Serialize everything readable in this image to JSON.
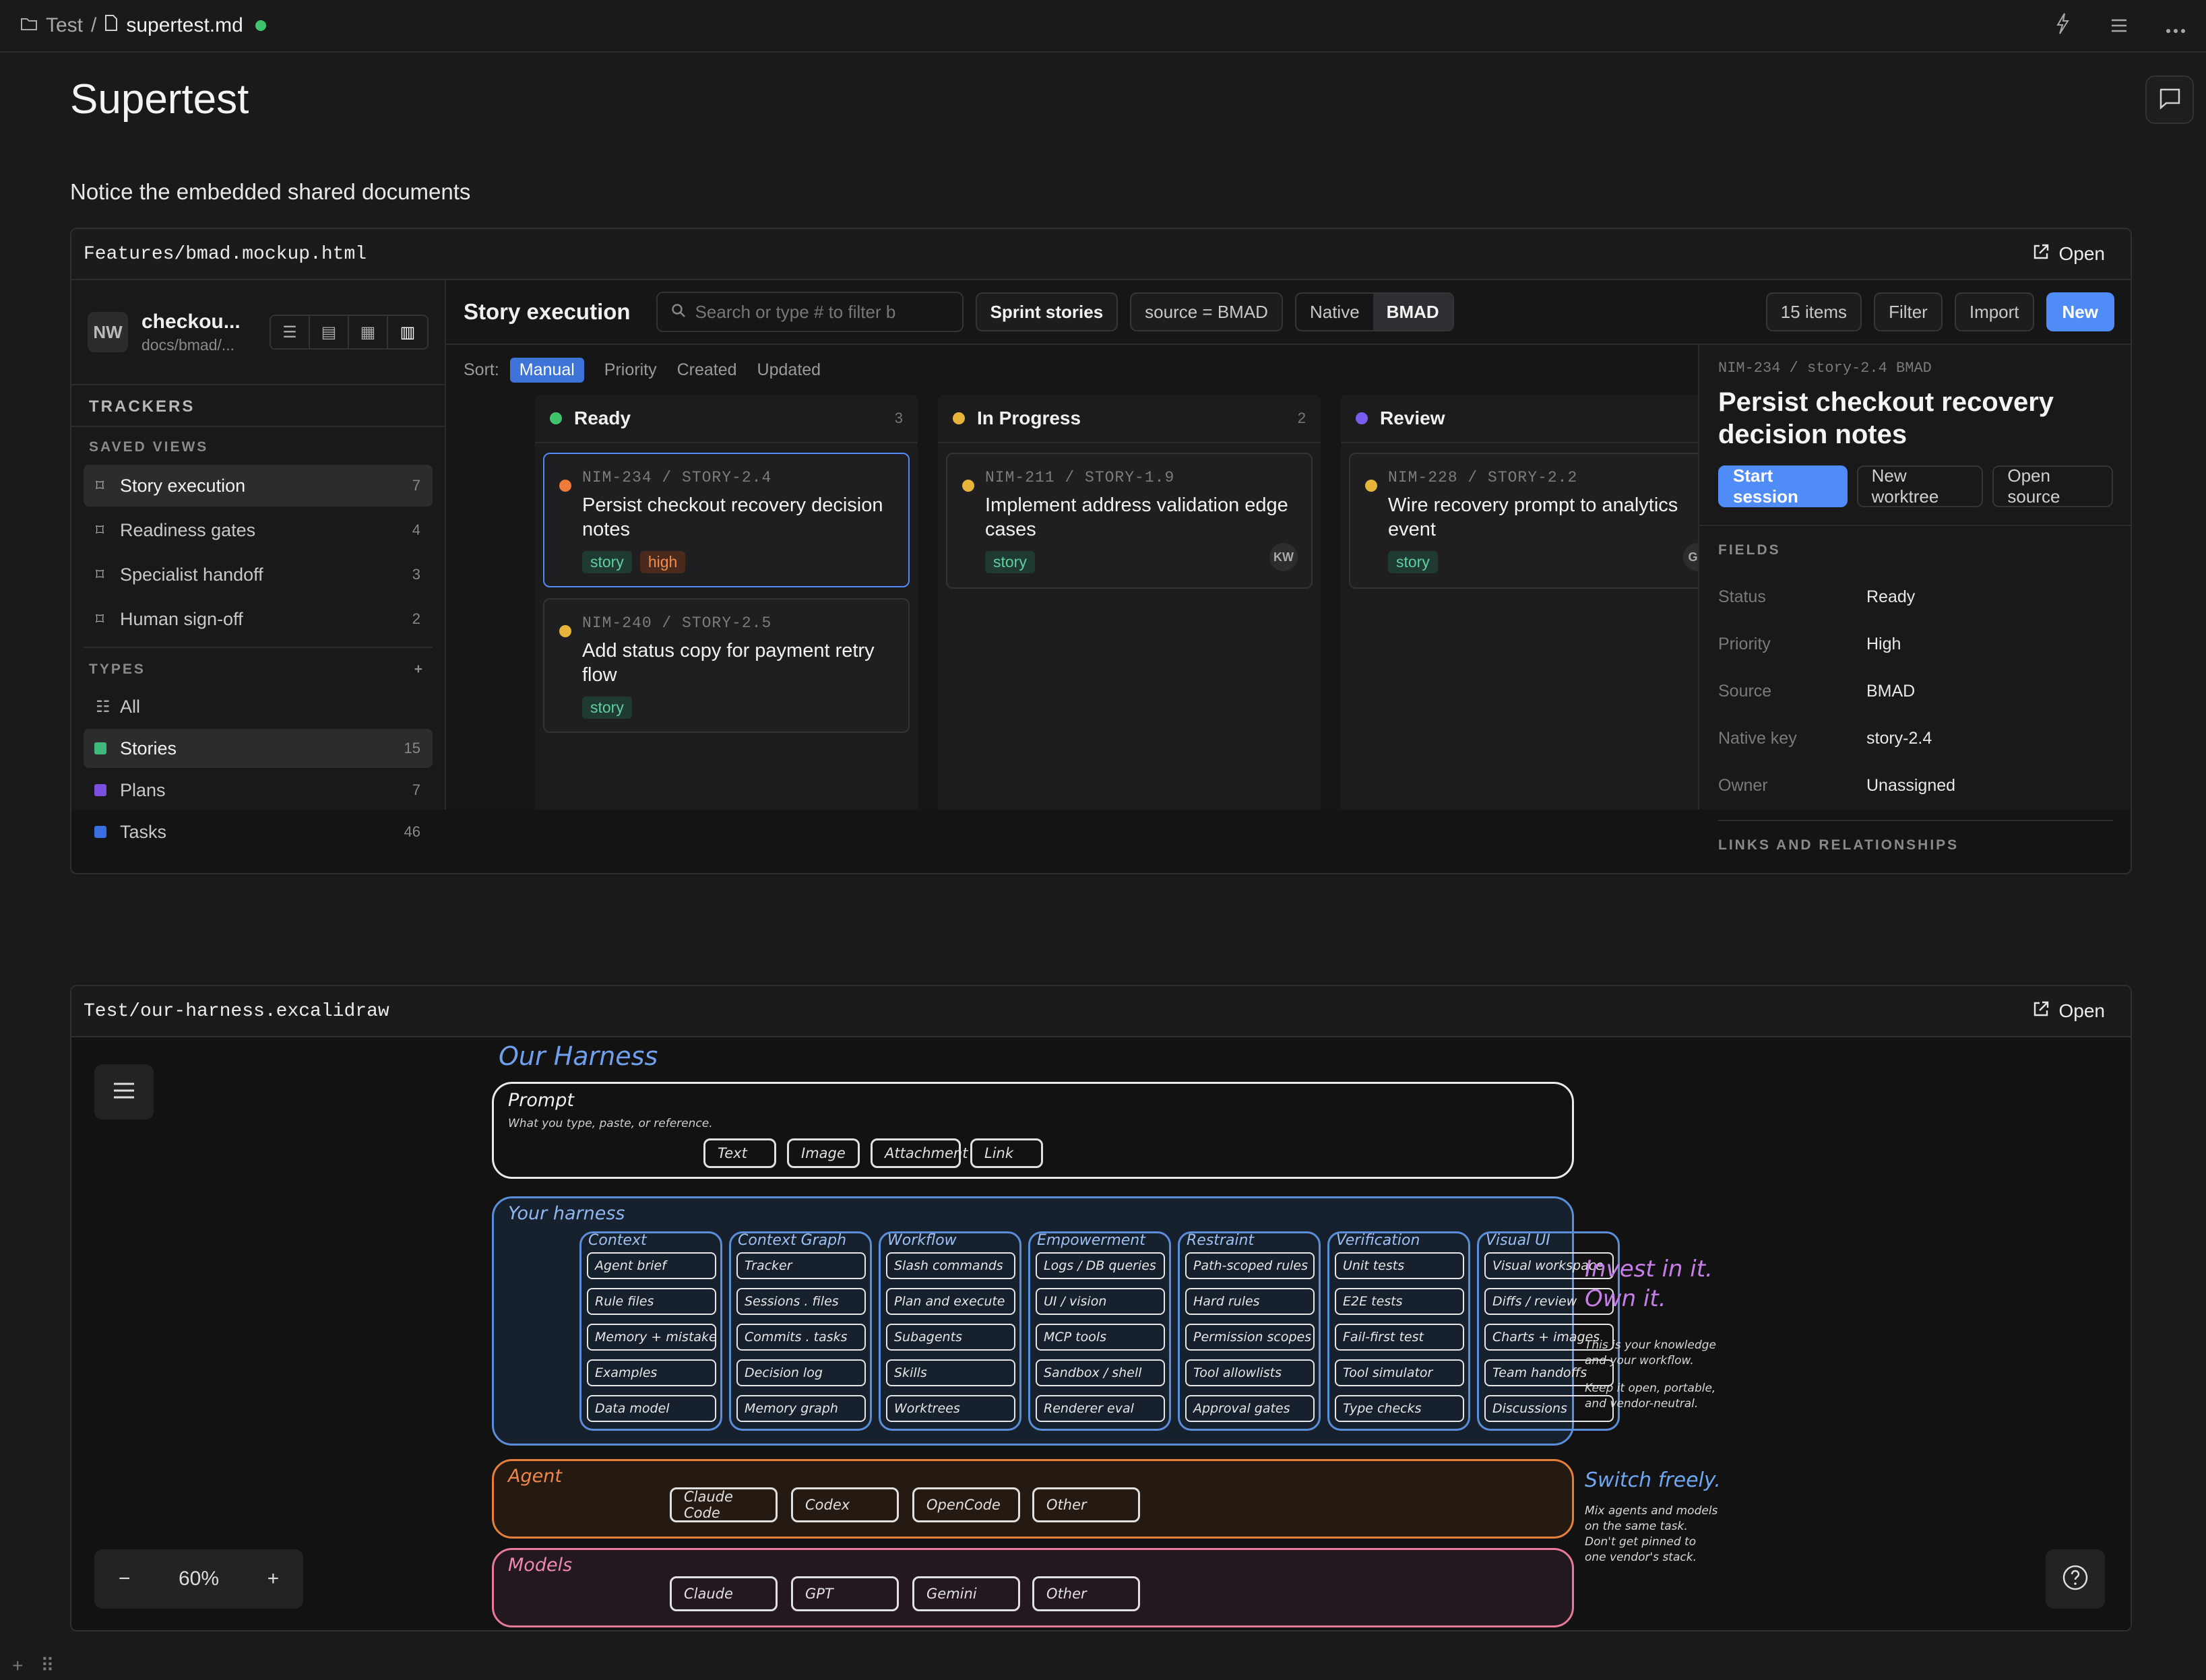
{
  "topbar": {
    "folder": "Test",
    "sep": "/",
    "file": "supertest.md"
  },
  "page": {
    "title": "Supertest",
    "notice": "Notice the embedded shared documents"
  },
  "embed1": {
    "path": "Features/bmad.mockup.html",
    "open": "Open"
  },
  "bmad": {
    "project": {
      "avatar": "NW",
      "name": "checkou...",
      "path": "docs/bmad/..."
    },
    "trackers_title": "TRACKERS",
    "saved_views_title": "SAVED VIEWS",
    "saved_views": [
      {
        "label": "Story execution",
        "count": "7"
      },
      {
        "label": "Readiness gates",
        "count": "4"
      },
      {
        "label": "Specialist handoff",
        "count": "3"
      },
      {
        "label": "Human sign-off",
        "count": "2"
      }
    ],
    "types_title": "TYPES",
    "types_add": "+",
    "types": [
      {
        "label": "All",
        "count": ""
      },
      {
        "label": "Stories",
        "count": "15",
        "color": "#3fb97a"
      },
      {
        "label": "Plans",
        "count": "7",
        "color": "#7b4fe0"
      },
      {
        "label": "Tasks",
        "count": "46",
        "color": "#3a6fe2"
      }
    ],
    "toolbar": {
      "title": "Story execution",
      "search_placeholder": "Search or type # to filter b",
      "sprint": "Sprint stories",
      "source": "source = BMAD",
      "native": "Native",
      "bmad": "BMAD",
      "items": "15 items",
      "filter": "Filter",
      "import": "Import",
      "new": "New"
    },
    "sort": {
      "label": "Sort:",
      "options": [
        "Manual",
        "Priority",
        "Created",
        "Updated"
      ]
    },
    "columns": [
      {
        "name": "Ready",
        "count": "3",
        "color": "#3ec46d"
      },
      {
        "name": "In Progress",
        "count": "2",
        "color": "#e6b43a"
      },
      {
        "name": "Review",
        "count": "",
        "color": "#7b5cf0"
      }
    ],
    "cards": [
      {
        "key": "NIM-234 / STORY-2.4",
        "title": "Persist checkout recovery decision notes",
        "tags": [
          "story",
          "high"
        ],
        "dot": "#f07c3a"
      },
      {
        "key": "NIM-240 / STORY-2.5",
        "title": "Add status copy for payment retry flow",
        "tags": [
          "story"
        ],
        "dot": "#e6b43a"
      },
      {
        "key": "NIM-211 / STORY-1.9",
        "title": "Implement address validation edge cases",
        "tags": [
          "story"
        ],
        "avatar": "KW",
        "dot": "#e6b43a"
      },
      {
        "key": "NIM-228 / STORY-2.2",
        "title": "Wire recovery prompt to analytics event",
        "tags": [
          "story"
        ],
        "avatar": "GH",
        "dot": "#e6b43a"
      }
    ],
    "detail": {
      "key": "NIM-234 / story-2.4 BMAD",
      "title": "Persist checkout recovery decision notes",
      "start": "Start session",
      "worktree": "New worktree",
      "open_source": "Open source",
      "fields_title": "FIELDS",
      "fields": [
        {
          "k": "Status",
          "v": "Ready"
        },
        {
          "k": "Priority",
          "v": "High"
        },
        {
          "k": "Source",
          "v": "BMAD"
        },
        {
          "k": "Native key",
          "v": "story-2.4"
        },
        {
          "k": "Owner",
          "v": "Unassigned"
        }
      ],
      "links_title": "LINKS AND RELATIONSHIPS"
    }
  },
  "embed2": {
    "path": "Test/our-harness.excalidraw",
    "open": "Open",
    "zoom": "60%",
    "zoom_minus": "−",
    "zoom_plus": "+"
  },
  "harness": {
    "title": "Our Harness",
    "prompt": {
      "label": "Prompt",
      "sub": "What you type, paste, or reference.",
      "chips": [
        "Text",
        "Image",
        "Attachment",
        "Link"
      ]
    },
    "harness_label": "Your harness",
    "columns": [
      {
        "h": "Context",
        "items": [
          "Agent brief",
          "Rule files",
          "Memory + mistakes",
          "Examples",
          "Data model"
        ]
      },
      {
        "h": "Context Graph",
        "items": [
          "Tracker",
          "Sessions . files",
          "Commits . tasks",
          "Decision log",
          "Memory graph"
        ]
      },
      {
        "h": "Workflow",
        "items": [
          "Slash commands",
          "Plan and execute",
          "Subagents",
          "Skills",
          "Worktrees"
        ]
      },
      {
        "h": "Empowerment",
        "items": [
          "Logs / DB queries",
          "UI / vision",
          "MCP tools",
          "Sandbox / shell",
          "Renderer eval"
        ]
      },
      {
        "h": "Restraint",
        "items": [
          "Path-scoped rules",
          "Hard rules",
          "Permission scopes",
          "Tool allowlists",
          "Approval gates"
        ]
      },
      {
        "h": "Verification",
        "items": [
          "Unit tests",
          "E2E tests",
          "Fail-first test",
          "Tool simulator",
          "Type checks"
        ]
      },
      {
        "h": "Visual UI",
        "items": [
          "Visual workspace",
          "Diffs / review",
          "Charts + images",
          "Team handoffs",
          "Discussions"
        ]
      }
    ],
    "agent": {
      "label": "Agent",
      "chips": [
        "Claude Code",
        "Codex",
        "OpenCode",
        "Other"
      ]
    },
    "models": {
      "label": "Models",
      "chips": [
        "Claude",
        "GPT",
        "Gemini",
        "Other"
      ]
    },
    "invest": {
      "title1": "Invest in it.",
      "title2": "Own it.",
      "p1a": "This is your knowledge",
      "p1b": "and your workflow.",
      "p2a": "Keep it open, portable,",
      "p2b": "and vendor-neutral."
    },
    "switch": {
      "title": "Switch freely.",
      "l1": "Mix agents and models",
      "l2": "on the same task.",
      "l3": "Don't get pinned to",
      "l4": "one vendor's stack."
    }
  }
}
